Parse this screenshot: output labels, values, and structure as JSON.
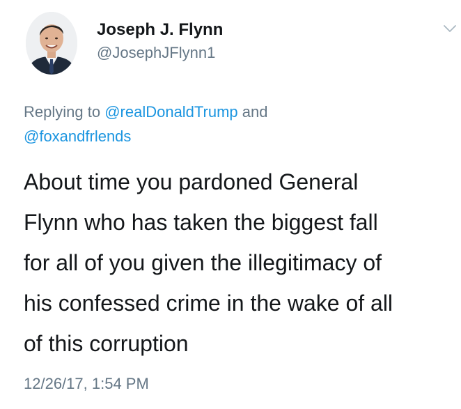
{
  "author": {
    "display_name": "Joseph J. Flynn",
    "handle": "@JosephJFlynn1",
    "avatar_icon": "profile-photo-icon"
  },
  "menu_icon": "chevron-down-icon",
  "reply": {
    "prefix": "Replying to ",
    "mention_1": "@realDonaldTrump",
    "connector": " and",
    "mention_2": "@foxandfrlends"
  },
  "tweet_lines": [
    "About time you pardoned General",
    "Flynn who has taken the biggest fall",
    "for all of you given the illegitimacy of",
    "his confessed crime in the wake of all",
    "of this corruption"
  ],
  "timestamp": "12/26/17, 1:54 PM",
  "colors": {
    "text": "#14171a",
    "muted": "#657786",
    "link": "#1b95e0",
    "background": "#ffffff"
  }
}
